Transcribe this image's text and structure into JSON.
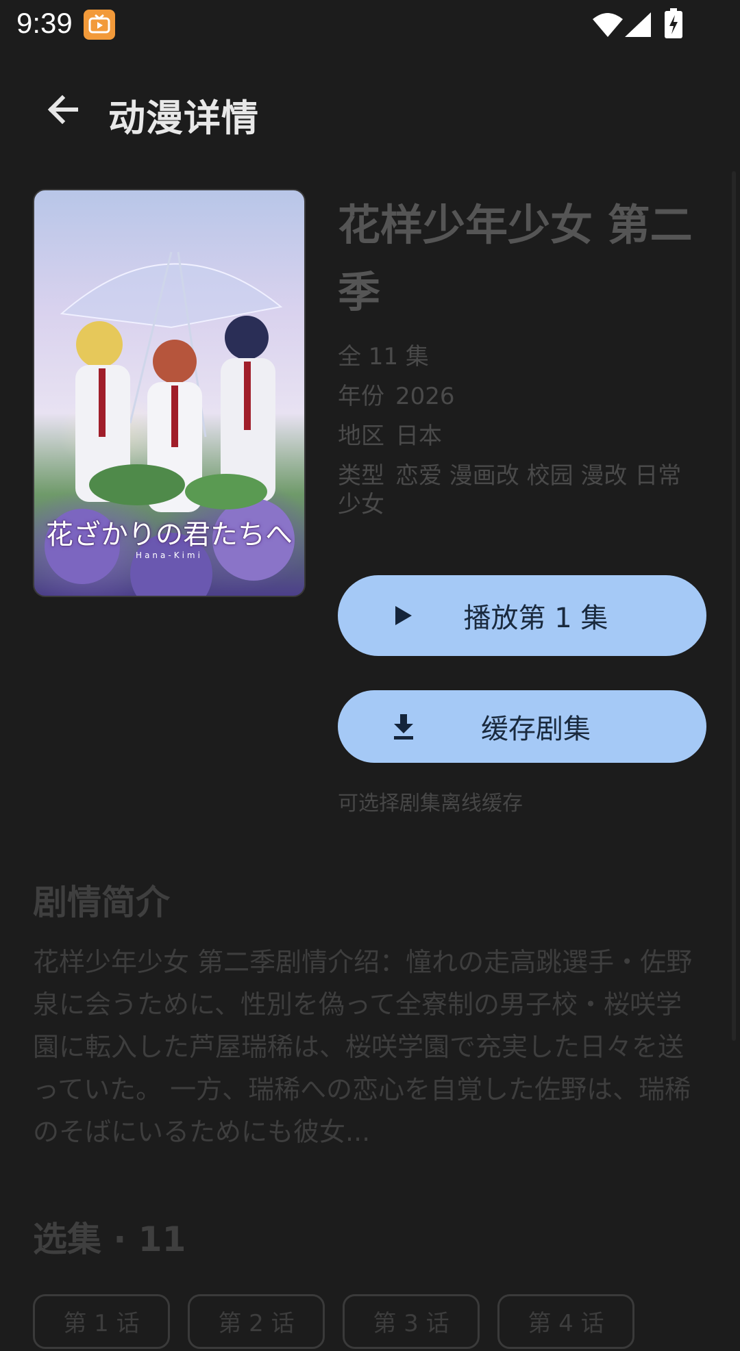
{
  "status_bar": {
    "time": "9:39",
    "icons": [
      "tv-app-icon",
      "wifi-icon",
      "signal-icon",
      "battery-charging-icon"
    ]
  },
  "app_bar": {
    "title": "动漫详情",
    "back_icon": "arrow-back-icon"
  },
  "anime": {
    "title": "花样少年少女 第二季",
    "cover_logo": "花ざかりの君たちへ",
    "cover_sub": "Hana-Kimi",
    "episodes_text": "全 11 集",
    "year_label": "年份",
    "year": "2026",
    "region_label": "地区",
    "region": "日本",
    "genre_label": "类型",
    "genres": "恋爱 漫画改 校园 漫改 日常 少女"
  },
  "actions": {
    "play_label": "播放第 1 集",
    "cache_label": "缓存剧集",
    "cache_hint": "可选择剧集离线缓存"
  },
  "synopsis": {
    "title": "剧情简介",
    "text": "花样少年少女 第二季剧情介绍：憧れの走高跳選手・佐野泉に会うために、性別を偽って全寮制の男子校・桜咲学園に転入した芦屋瑞稀は、桜咲学園で充実した日々を送っていた。 一方、瑞稀への恋心を自覚した佐野は、瑞稀のそばにいるためにも彼女..."
  },
  "episodes": {
    "title": "选集 · 11",
    "chips": [
      "第 1 话",
      "第 2 话",
      "第 3 话",
      "第 4 话"
    ]
  },
  "colors": {
    "background": "#1c1c1c",
    "button": "#a5c9f6",
    "button_text": "#1a2a3e",
    "muted_text": "#4a4a4a"
  }
}
